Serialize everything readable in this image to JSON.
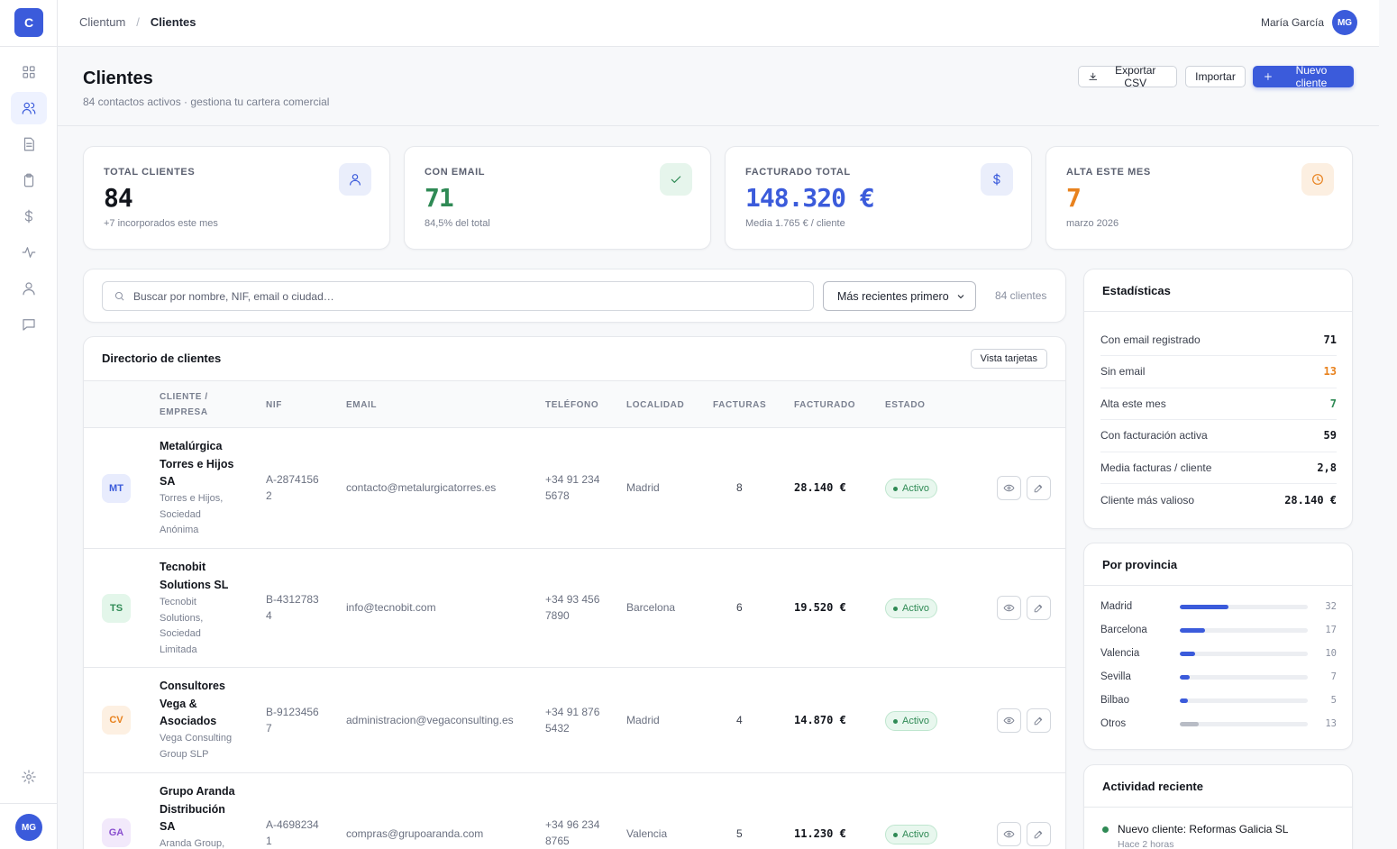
{
  "app": {
    "logo_letter": "C",
    "name": "Clientum"
  },
  "breadcrumb": {
    "root": "Clientum",
    "separator": "/",
    "current": "Clientes"
  },
  "user": {
    "name": "María García",
    "initials": "MG"
  },
  "page": {
    "title": "Clientes",
    "subtitle": "84 contactos activos · gestiona tu cartera comercial",
    "export_label": "Exportar CSV",
    "import_label": "Importar",
    "new_label": "Nuevo cliente"
  },
  "nav_icons": [
    "grid-icon",
    "users-icon",
    "invoice-icon",
    "clipboard-icon",
    "dollar-icon",
    "activity-icon",
    "user-icon",
    "chat-icon",
    "settings-icon"
  ],
  "kpis": [
    {
      "label": "TOTAL CLIENTES",
      "value": "84",
      "hint": "+7 incorporados este mes",
      "color": "#12151c",
      "icon": "user-icon"
    },
    {
      "label": "CON EMAIL",
      "value": "71",
      "hint": "84,5% del total",
      "color": "#2f8a55",
      "icon": "check-icon"
    },
    {
      "label": "FACTURADO TOTAL",
      "value": "148.320 €",
      "hint": "Media 1.765 € / cliente",
      "color": "#3b5bdb",
      "icon": "dollar-icon"
    },
    {
      "label": "ALTA ESTE MES",
      "value": "7",
      "hint": "marzo 2026",
      "color": "#e8821e",
      "icon": "clock-icon"
    }
  ],
  "search": {
    "placeholder": "Buscar por nombre, NIF, email o ciudad…",
    "sort_value": "Más recientes primero",
    "count": "84 clientes"
  },
  "directory": {
    "title": "Directorio de clientes",
    "view_toggle": "Vista tarjetas",
    "columns": [
      "CLIENTE / EMPRESA",
      "NIF",
      "EMAIL",
      "TELÉFONO",
      "LOCALIDAD",
      "FACTURAS",
      "FACTURADO",
      "ESTADO"
    ],
    "rows": [
      {
        "initials": "MT",
        "name": "Metalúrgica Torres e Hijos SA",
        "legal": "Torres e Hijos, Sociedad Anónima",
        "nif": "A-28741562",
        "email": "contacto@metalurgicatorres.es",
        "phone": "+34 91 234 5678",
        "city": "Madrid",
        "invoices": "8",
        "amount": "28.140 €",
        "status": "Activo",
        "av_bg": "#e8ecfd",
        "av_fg": "#3b5bdb"
      },
      {
        "initials": "TS",
        "name": "Tecnobit Solutions SL",
        "legal": "Tecnobit Solutions, Sociedad Limitada",
        "nif": "B-43127834",
        "email": "info@tecnobit.com",
        "phone": "+34 93 456 7890",
        "city": "Barcelona",
        "invoices": "6",
        "amount": "19.520 €",
        "status": "Activo",
        "av_bg": "#e3f6ea",
        "av_fg": "#2f8a55"
      },
      {
        "initials": "CV",
        "name": "Consultores Vega & Asociados",
        "legal": "Vega Consulting Group SLP",
        "nif": "B-91234567",
        "email": "administracion@vegaconsulting.es",
        "phone": "+34 91 876 5432",
        "city": "Madrid",
        "invoices": "4",
        "amount": "14.870 €",
        "status": "Activo",
        "av_bg": "#fdf0e2",
        "av_fg": "#e8821e"
      },
      {
        "initials": "GA",
        "name": "Grupo Aranda Distribución SA",
        "legal": "Aranda Group,",
        "nif": "A-46982341",
        "email": "compras@grupoaranda.com",
        "phone": "+34 96 234 8765",
        "city": "Valencia",
        "invoices": "5",
        "amount": "11.230 €",
        "status": "Activo",
        "av_bg": "#f2e9fb",
        "av_fg": "#8a4fcf"
      }
    ]
  },
  "stats": {
    "title": "Estadísticas",
    "items": [
      {
        "label": "Con email registrado",
        "value": "71",
        "color": "#12151c"
      },
      {
        "label": "Sin email",
        "value": "13",
        "color": "#e8821e"
      },
      {
        "label": "Alta este mes",
        "value": "7",
        "color": "#2f8a55"
      },
      {
        "label": "Con facturación activa",
        "value": "59",
        "color": "#12151c"
      },
      {
        "label": "Media facturas / cliente",
        "value": "2,8",
        "color": "#12151c"
      },
      {
        "label": "Cliente más valioso",
        "value": "28.140 €",
        "color": "#12151c"
      }
    ]
  },
  "provinces": {
    "title": "Por provincia",
    "items": [
      {
        "name": "Madrid",
        "value": "32",
        "fraction": 0.38
      },
      {
        "name": "Barcelona",
        "value": "17",
        "fraction": 0.2
      },
      {
        "name": "Valencia",
        "value": "10",
        "fraction": 0.12
      },
      {
        "name": "Sevilla",
        "value": "7",
        "fraction": 0.08
      },
      {
        "name": "Bilbao",
        "value": "5",
        "fraction": 0.06
      },
      {
        "name": "Otros",
        "value": "13",
        "fraction": 0.15
      }
    ]
  },
  "activity": {
    "title": "Actividad reciente",
    "items": [
      {
        "text": "Nuevo cliente: Reformas Galicia SL",
        "time": "Hace 2 horas"
      }
    ]
  }
}
